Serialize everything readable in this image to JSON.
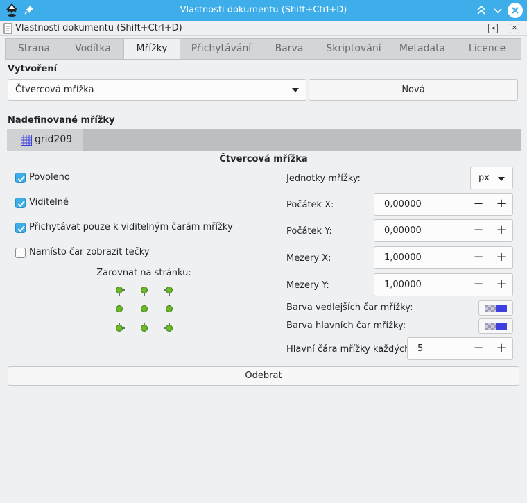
{
  "window": {
    "title": "Vlastnosti dokumentu (Shift+Ctrl+D)"
  },
  "dock": {
    "title": "Vlastnosti dokumentu (Shift+Ctrl+D)"
  },
  "tabs": [
    {
      "label": "Strana"
    },
    {
      "label": "Vodítka"
    },
    {
      "label": "Mřížky"
    },
    {
      "label": "Přichytávání"
    },
    {
      "label": "Barva"
    },
    {
      "label": "Skriptování"
    },
    {
      "label": "Metadata"
    },
    {
      "label": "Licence"
    }
  ],
  "active_tab": "Mřížky",
  "creation": {
    "label": "Vytvoření",
    "grid_type": "Čtvercová mřížka",
    "new_button": "Nová"
  },
  "defined": {
    "label": "Nadefinované mřížky",
    "grid_name": "grid209"
  },
  "grid": {
    "heading": "Čtvercová mřížka",
    "enabled": {
      "label": "Povoleno",
      "checked": true
    },
    "visible": {
      "label": "Viditelné",
      "checked": true
    },
    "snap_visible": {
      "label": "Přichytávat pouze k viditelným čarám mřížky",
      "checked": true
    },
    "dots": {
      "label": "Namísto čar zobrazit tečky",
      "checked": false
    },
    "align_label": "Zarovnat na stránku:",
    "units_label": "Jednotky mřížky:",
    "units_value": "px",
    "origin_x_label": "Počátek X:",
    "origin_x": "0,00000",
    "origin_y_label": "Počátek Y:",
    "origin_y": "0,00000",
    "spacing_x_label": "Mezery X:",
    "spacing_x": "1,00000",
    "spacing_y_label": "Mezery Y:",
    "spacing_y": "1,00000",
    "minor_color_label": "Barva vedlejších čar mřížky:",
    "major_color_label": "Barva hlavních čar mřížky:",
    "major_every_label": "Hlavní čára mřížky každých:",
    "major_every": "5",
    "minus": "−",
    "plus": "+",
    "remove_button": "Odebrat"
  },
  "colors": {
    "accent": "#3daee9",
    "grid_line": "#3f3fe0",
    "align_dot": "#6cb82a"
  }
}
